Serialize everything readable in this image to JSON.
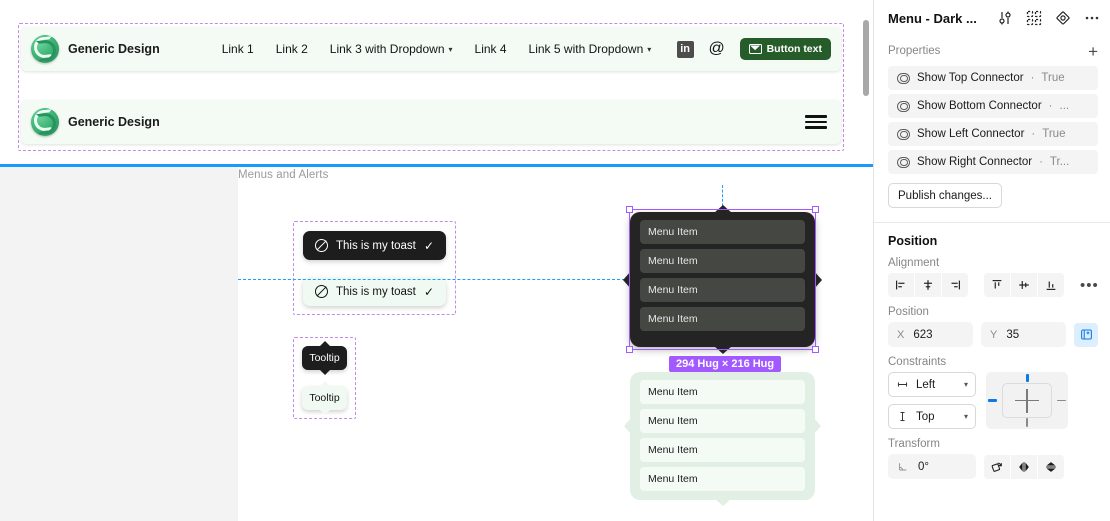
{
  "canvas": {
    "section_label": "Menus and Alerts",
    "navbar": {
      "brand_name": "Generic Design",
      "links": [
        {
          "label": "Link 1",
          "has_dropdown": false
        },
        {
          "label": "Link 2",
          "has_dropdown": false
        },
        {
          "label": "Link 3 with Dropdown",
          "has_dropdown": true
        },
        {
          "label": "Link 4",
          "has_dropdown": false
        },
        {
          "label": "Link 5 with Dropdown",
          "has_dropdown": true
        }
      ],
      "social_icons": [
        "linkedin-icon",
        "threads-icon"
      ],
      "cta_label": "Button text",
      "cta_icon": "envelope-icon",
      "cta_color": "#255c29",
      "background": "#f3fbf4"
    },
    "navbar_mobile": {
      "brand_name": "Generic Design",
      "menu_icon": "hamburger-icon"
    },
    "toasts": [
      {
        "text": "This is my toast",
        "theme": "dark",
        "leading_icon": "ban-icon",
        "trailing_icon": "check-icon"
      },
      {
        "text": "This is my toast",
        "theme": "light",
        "leading_icon": "ban-icon",
        "trailing_icon": "check-icon"
      }
    ],
    "tooltips": [
      {
        "text": "Tooltip",
        "theme": "dark"
      },
      {
        "text": "Tooltip",
        "theme": "light"
      }
    ],
    "menu_dark": {
      "items": [
        "Menu Item",
        "Menu Item",
        "Menu Item",
        "Menu Item"
      ],
      "background": "#242424",
      "item_background": "#454742"
    },
    "menu_light": {
      "items": [
        "Menu Item",
        "Menu Item",
        "Menu Item",
        "Menu Item"
      ],
      "background": "#e2efe4",
      "item_background": "#f4fbf5"
    },
    "selection": {
      "size_badge": "294 Hug × 216 Hug",
      "accent_color": "#a259ff",
      "guide_color": "#18a0fb"
    }
  },
  "panel": {
    "title": "Menu - Dark ...",
    "header_icons": [
      "tune-icon",
      "component-icon",
      "variant-icon",
      "more-icon"
    ],
    "properties": {
      "section_label": "Properties",
      "add_label": "+",
      "rows": [
        {
          "name": "Show Top Connector",
          "separator": "·",
          "value": "True"
        },
        {
          "name": "Show Bottom Connector",
          "separator": "·",
          "value": "..."
        },
        {
          "name": "Show Left Connector",
          "separator": "·",
          "value": "True"
        },
        {
          "name": "Show Right Connector",
          "separator": "·",
          "value": "Tr..."
        }
      ],
      "publish_label": "Publish changes..."
    },
    "position": {
      "title": "Position",
      "alignment_label": "Alignment",
      "alignment_buttons": [
        "align-left-icon",
        "align-horizontal-center-icon",
        "align-right-icon",
        "align-top-icon",
        "align-vertical-center-icon",
        "align-bottom-icon"
      ],
      "alignment_more": "•••",
      "position_label": "Position",
      "x_prefix": "X",
      "x_value": "623",
      "y_prefix": "Y",
      "y_value": "35",
      "absolute_position_icon": "absolute-position-icon",
      "constraints_label": "Constraints",
      "horizontal_constraint": "Left",
      "vertical_constraint": "Top",
      "constraint_active_color": "#0d7ae5",
      "transform_label": "Transform",
      "rotation_prefix": "rotation-icon",
      "rotation_value": "0°",
      "transform_buttons": [
        "rotate-icon",
        "flip-horizontal-icon",
        "flip-vertical-icon"
      ]
    }
  }
}
